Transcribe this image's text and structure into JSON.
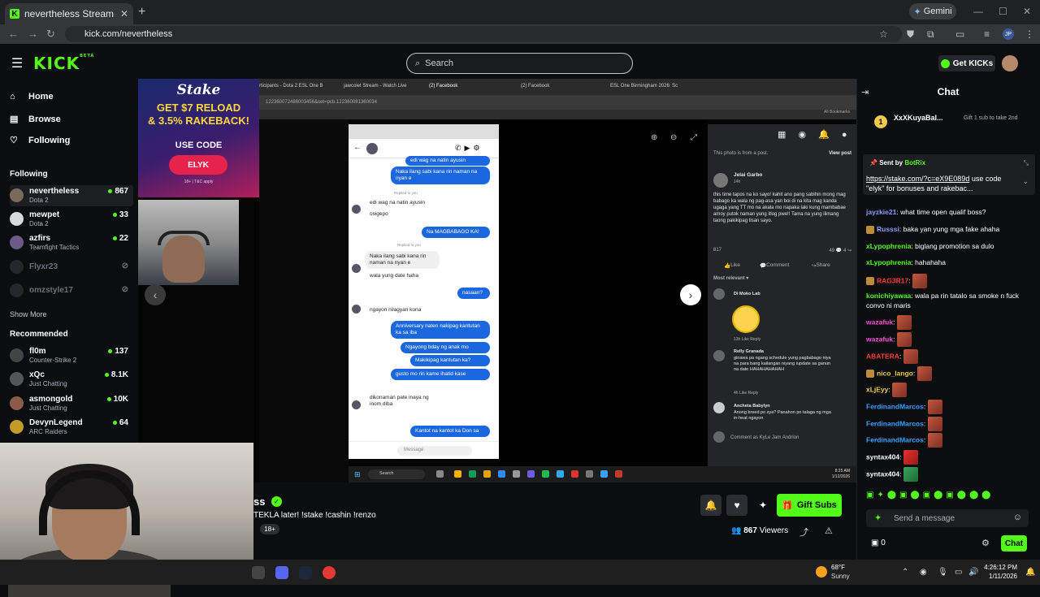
{
  "browser": {
    "tab_title": "nevertheless Stream - Watch Li...",
    "url": "kick.com/nevertheless",
    "gemini_label": "Gemini"
  },
  "header": {
    "logo": "KICK",
    "logo_sup": "BETA",
    "search_placeholder": "Search",
    "get_kicks_label": "Get KICKs"
  },
  "sidebar": {
    "nav": [
      {
        "label": "Home",
        "icon": "home-icon"
      },
      {
        "label": "Browse",
        "icon": "browse-icon"
      },
      {
        "label": "Following",
        "icon": "heart-icon"
      }
    ],
    "following_title": "Following",
    "following": [
      {
        "name": "nevertheless",
        "category": "Dota 2",
        "viewers": "867",
        "live": true
      },
      {
        "name": "mewpet",
        "category": "Dota 2",
        "viewers": "33",
        "live": true
      },
      {
        "name": "azfirs",
        "category": "Teamfight Tactics",
        "viewers": "22",
        "live": true
      },
      {
        "name": "Flyxr23",
        "category": "",
        "viewers": "",
        "live": false
      },
      {
        "name": "omzstyle17",
        "category": "",
        "viewers": "",
        "live": false
      }
    ],
    "show_more": "Show More",
    "recommended_title": "Recommended",
    "recommended": [
      {
        "name": "fl0m",
        "category": "Counter-Strike 2",
        "viewers": "137"
      },
      {
        "name": "xQc",
        "category": "Just Chatting",
        "viewers": "8.1K"
      },
      {
        "name": "asmongold",
        "category": "Just Chatting",
        "viewers": "10K"
      },
      {
        "name": "DevynLegend",
        "category": "ARC Raiders",
        "viewers": "64"
      }
    ]
  },
  "ad": {
    "brand": "Stake",
    "line1": "GET $7 RELOAD",
    "line2": "& 3.5% RAKEBACK!",
    "use_code": "USE CODE",
    "code": "ELYK",
    "fine": "18+ | T&C apply"
  },
  "inner_browser": {
    "tabs": [
      "rticipants - Dota 2 ESL One B",
      "jawcolet Stream - Watch Live",
      "(2) Facebook",
      "(2) Facebook",
      "ESL One Birmingham 2026: Sc"
    ],
    "url": "122360072486003456&set=pcb.122360081360034",
    "bookmarks": "All Bookmarks"
  },
  "messenger": {
    "messages": [
      {
        "type": "sent",
        "text": "edi wag na natin ayusin"
      },
      {
        "type": "sent",
        "text": "Naka ilang sabi kana rin naman na nyan e"
      },
      {
        "type": "reply",
        "text": "Replied to you"
      },
      {
        "type": "recv",
        "text": "edi wag na natin ayusin"
      },
      {
        "type": "recv",
        "text": "osigepo"
      },
      {
        "type": "sent",
        "text": "Na MAGBABAGO KA!"
      },
      {
        "type": "reply",
        "text": "Replied to you"
      },
      {
        "type": "recv",
        "text": "Naka ilang sabi kana rin naman na nyan e"
      },
      {
        "type": "recv",
        "text": "wala yung date haha"
      },
      {
        "type": "sent",
        "text": "nasaan?"
      },
      {
        "type": "recv",
        "text": "ngayon nilagyan kona"
      },
      {
        "type": "sent",
        "text": "Anniversary naten nakipag kantutan ka sa iba"
      },
      {
        "type": "sent",
        "text": "Ngayong bday ng anak mo"
      },
      {
        "type": "sent",
        "text": "Makikipag kantutan ka?"
      },
      {
        "type": "sent",
        "text": "gusto mo rin kame ihatid kase"
      },
      {
        "type": "recv",
        "text": "dikonaman pate inaya ng inom diba"
      },
      {
        "type": "sent",
        "text": "Kantot na kantot ka Don sa"
      }
    ],
    "input_placeholder": "Message"
  },
  "facebook": {
    "source_note": "This photo is from a post.",
    "view_post": "View post",
    "author": "Jelai Garbo",
    "time": "14h",
    "post_text": "this time tapos na ko sayo! kahit ano pang sabihin mong mag babago ka wala ng pag-asa yan boi di na kita mag kanda ugaga yang TT mo na akala mo napaka laki kung mambabae amoy putok naman yung itlog pwe!! Tama na yung ilimang taong pakikipag tisan sayo.",
    "reactions": "817",
    "comments_count": "49",
    "shares_count": "4",
    "like": "Like",
    "comment": "Comment",
    "share": "Share",
    "most_relevant": "Most relevant",
    "comments": [
      {
        "name": "Di Moko Lab",
        "text": "",
        "meta": "13h   Like   Reply"
      },
      {
        "name": "Relly Granada",
        "text": "ginawa pa ngang schedule yung pagbabago niya na para bang kailangan niyang iupdate sa ganun na date HAHAHAHAHAH",
        "meta": "4h   Like   Reply"
      },
      {
        "name": "Ancheta Babylyn",
        "text": "Anong breed po sya? Panahon po talaga ng mga in-heat ngayon",
        "meta": ""
      }
    ],
    "comment_placeholder": "Comment as KyLe Jam Andrion"
  },
  "inner_taskbar": {
    "search": "Search",
    "clock_time": "8:25 AM",
    "clock_date": "1/12/2026"
  },
  "stream": {
    "title_fragment": "ss",
    "subtitle": "TEKLA later! !stake !cashin !renzo",
    "age_tag": "18+",
    "gift_subs": "Gift Subs",
    "viewers": "867",
    "viewers_label": "Viewers"
  },
  "chat": {
    "title": "Chat",
    "top_gifter": {
      "rank": "1",
      "name": "XxXKuyaBal...",
      "note": "Gift 1 sub to take 2nd"
    },
    "pinned": {
      "sent_by": "Sent by",
      "bot": "BotRix",
      "link": "https://stake.com/?c=eX9E089d",
      "text": " use code \"elyk\" for bonuses and rakebac..."
    },
    "messages": [
      {
        "user": "jayzkie21",
        "color": "#8a9cff",
        "text": "what time open qualif boss?",
        "emotes": 0,
        "badge": false
      },
      {
        "user": "Russsi",
        "color": "#8a9cff",
        "text": "baka yan yung mga fake ahaha",
        "emotes": 0,
        "badge": true
      },
      {
        "user": "xLypophrenia",
        "color": "#53fc18",
        "text": "biglang promotion sa dulo",
        "emotes": 0,
        "badge": false
      },
      {
        "user": "xLypophrenia",
        "color": "#53fc18",
        "text": "hahahaha",
        "emotes": 0,
        "badge": false
      },
      {
        "user": "RAG3R17",
        "color": "#ff3b3b",
        "text": "",
        "emotes": 1,
        "badge": true
      },
      {
        "user": "konichiyawaa",
        "color": "#53fc18",
        "text": "wala pa rin tatalo sa smoke n fuck convo ni maris",
        "emotes": 0,
        "badge": false
      },
      {
        "user": "wazafuk",
        "color": "#ff4fd8",
        "text": "",
        "emotes": 1,
        "badge": false
      },
      {
        "user": "wazafuk",
        "color": "#ff4fd8",
        "text": "",
        "emotes": 1,
        "badge": false
      },
      {
        "user": "ABATERA",
        "color": "#ff3b3b",
        "text": "",
        "emotes": 1,
        "badge": false
      },
      {
        "user": "nico_lango",
        "color": "#f2c94c",
        "text": "",
        "emotes": 1,
        "badge": true
      },
      {
        "user": "xLjEyy",
        "color": "#f2c94c",
        "text": "",
        "emotes": 1,
        "badge": false
      },
      {
        "user": "FerdinandMarcos",
        "color": "#3b9cff",
        "text": "",
        "emotes": 1,
        "badge": false
      },
      {
        "user": "FerdinandMarcos",
        "color": "#3b9cff",
        "text": "",
        "emotes": 1,
        "badge": false
      },
      {
        "user": "FerdinandMarcos",
        "color": "#3b9cff",
        "text": "",
        "emotes": 1,
        "badge": false
      },
      {
        "user": "syntax404",
        "color": "#ffffff",
        "text": "",
        "emotes": 1,
        "badge": false
      },
      {
        "user": "syntax404",
        "color": "#ffffff",
        "text": "",
        "emotes": 1,
        "badge": false
      }
    ],
    "input_placeholder": "Send a message",
    "kicks_count": "0",
    "chat_button": "Chat"
  },
  "taskbar": {
    "temperature": "68°F",
    "condition": "Sunny",
    "time": "4:26:12 PM",
    "date": "1/11/2026"
  }
}
